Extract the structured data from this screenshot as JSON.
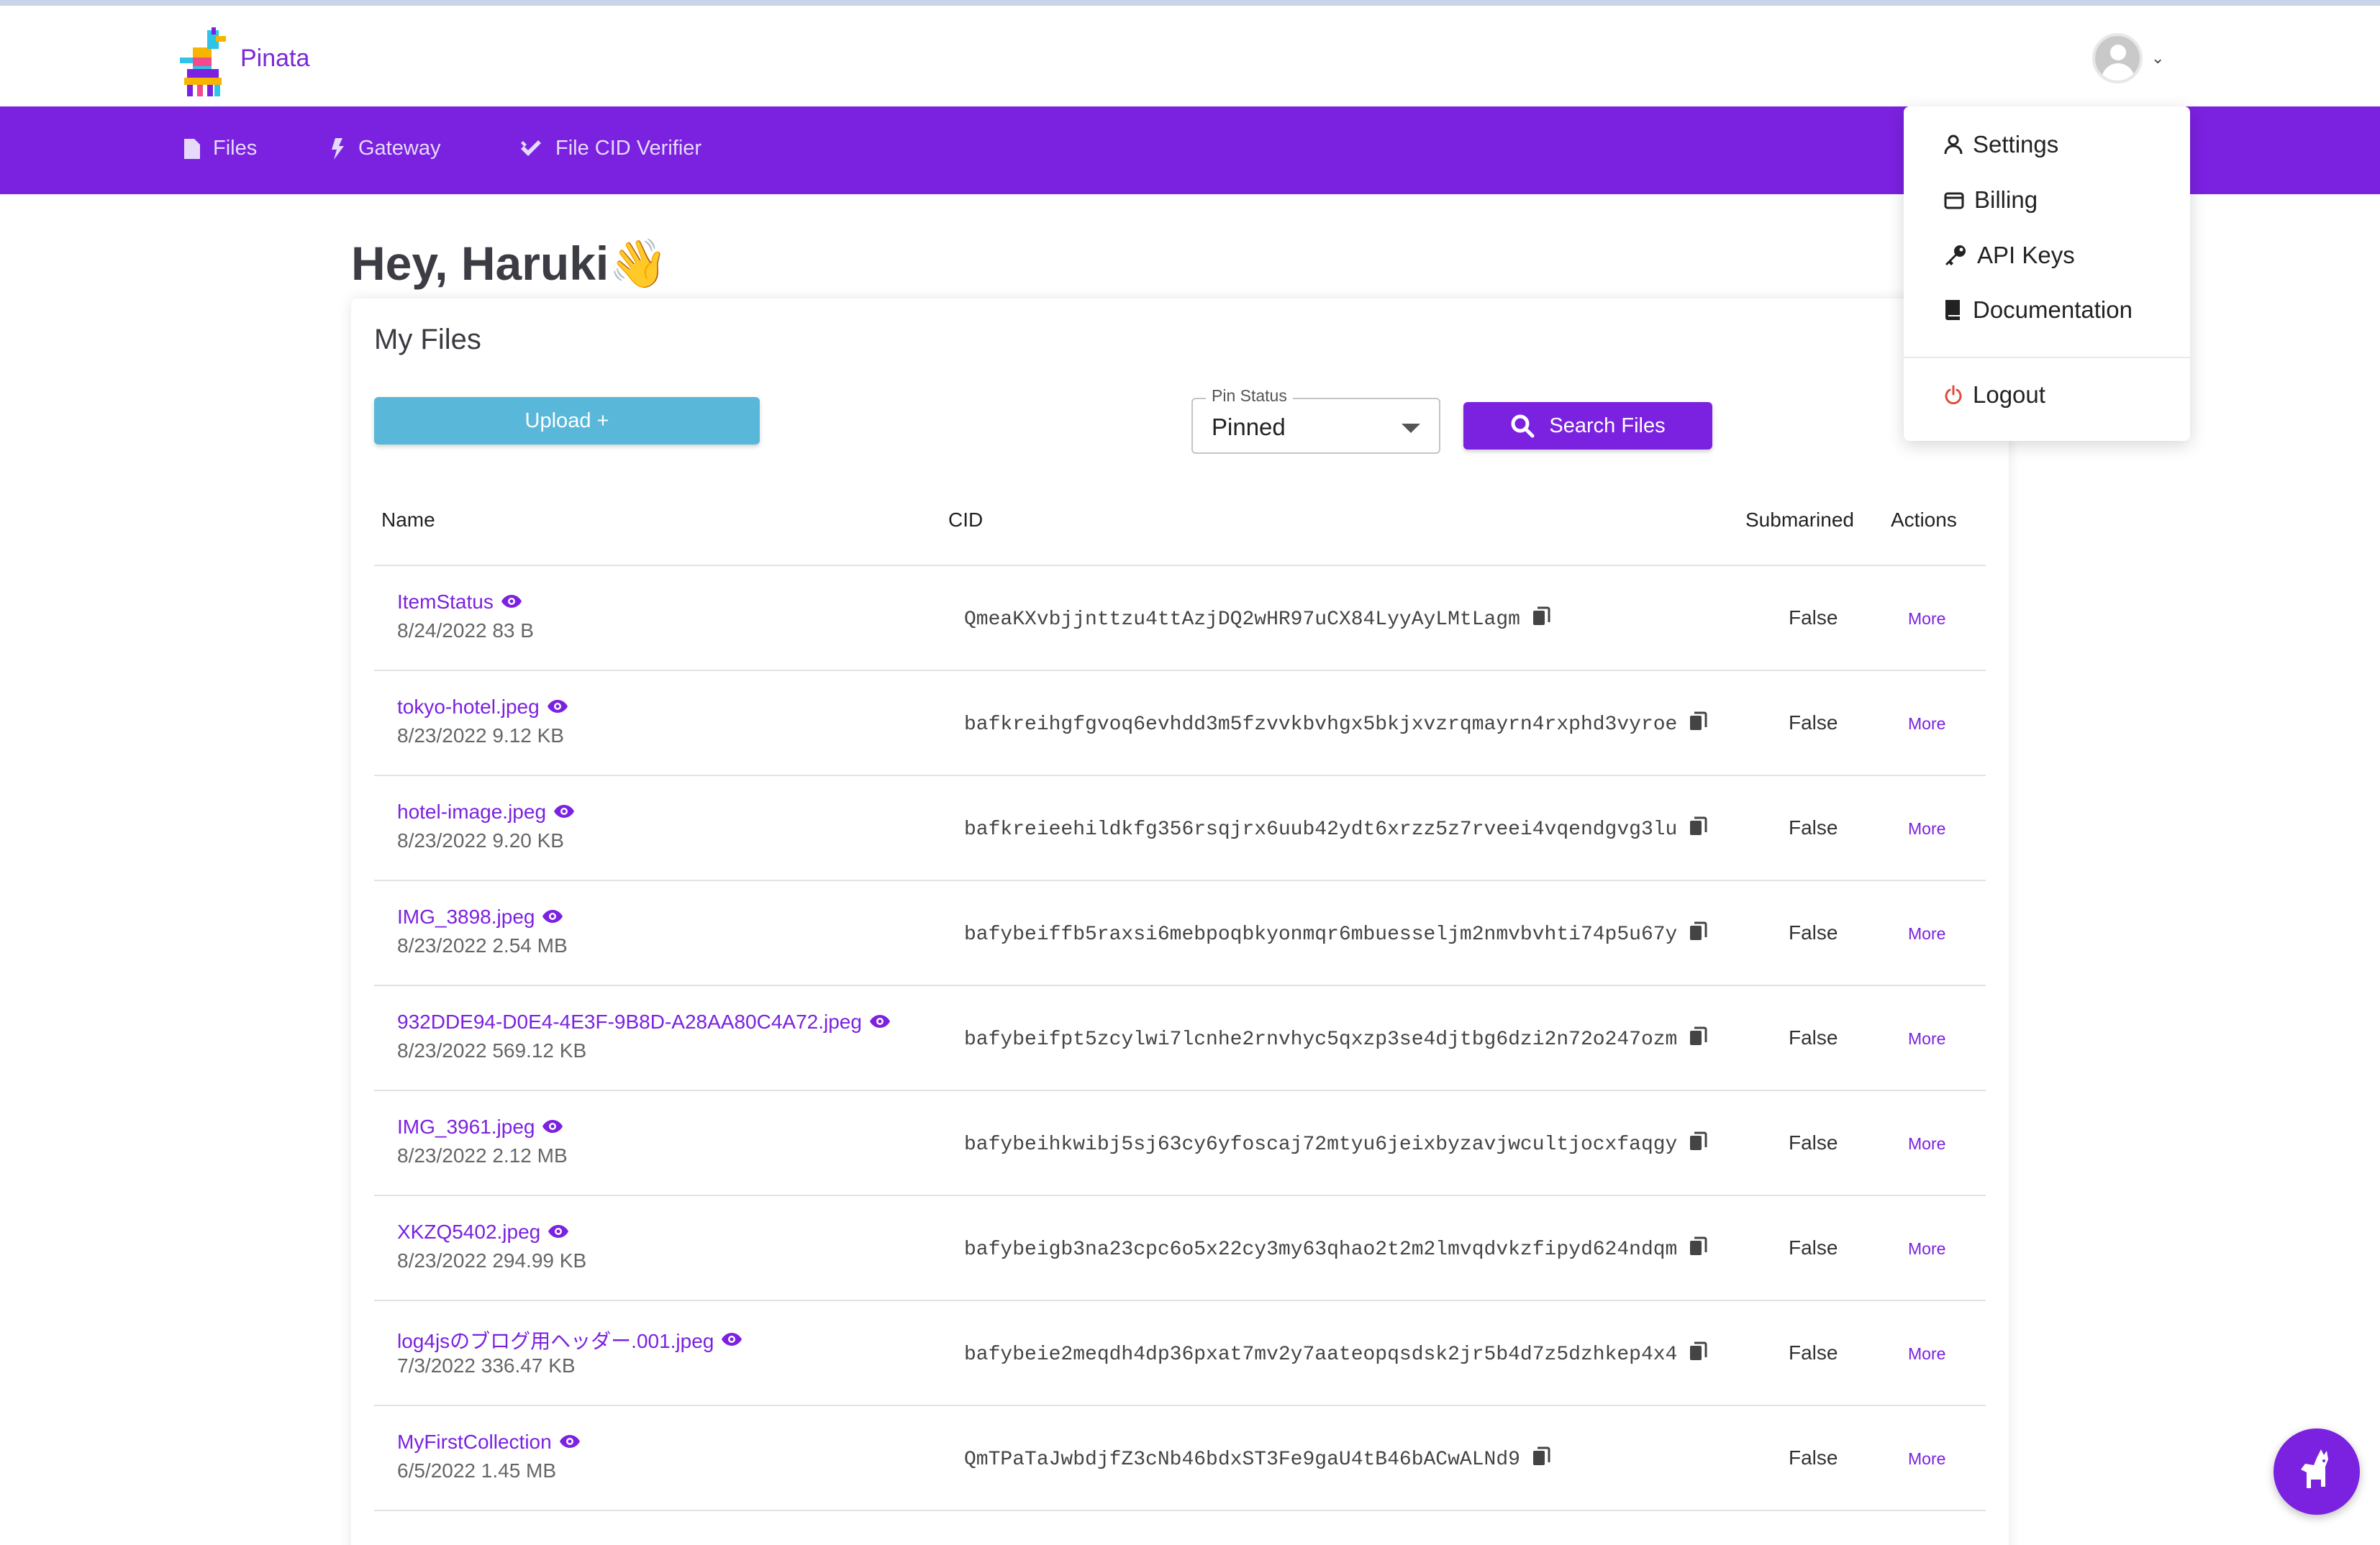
{
  "app": {
    "brand": "Pinata"
  },
  "nav": {
    "items": [
      {
        "label": "Files",
        "icon": "file-icon"
      },
      {
        "label": "Gateway",
        "icon": "bolt-icon"
      },
      {
        "label": "File CID Verifier",
        "icon": "double-check-icon"
      }
    ]
  },
  "greeting": "Hey, Haruki👋",
  "files": {
    "title": "My Files",
    "upload_label": "Upload +",
    "pin_status": {
      "label": "Pin Status",
      "value": "Pinned"
    },
    "search_label": "Search Files",
    "columns": [
      "Name",
      "CID",
      "Submarined",
      "Actions"
    ],
    "rows": [
      {
        "name": "ItemStatus",
        "meta": "8/24/2022 83 B",
        "cid": "QmeaKXvbjjnttzu4ttAzjDQ2wHR97uCX84LyyAyLMtLagm",
        "submarined": "False",
        "action": "More"
      },
      {
        "name": "tokyo-hotel.jpeg",
        "meta": "8/23/2022 9.12 KB",
        "cid": "bafkreihgfgvoq6evhdd3m5fzvvkbvhgx5bkjxvzrqmayrn4rxphd3vyroe",
        "submarined": "False",
        "action": "More"
      },
      {
        "name": "hotel-image.jpeg",
        "meta": "8/23/2022 9.20 KB",
        "cid": "bafkreieehildkfg356rsqjrx6uub42ydt6xrzz5z7rveei4vqendgvg3lu",
        "submarined": "False",
        "action": "More"
      },
      {
        "name": "IMG_3898.jpeg",
        "meta": "8/23/2022 2.54 MB",
        "cid": "bafybeiffb5raxsi6mebpoqbkyonmqr6mbuesseljm2nmvbvhti74p5u67y",
        "submarined": "False",
        "action": "More"
      },
      {
        "name": "932DDE94-D0E4-4E3F-9B8D-A28AA80C4A72.jpeg",
        "meta": "8/23/2022 569.12 KB",
        "cid": "bafybeifpt5zcylwi7lcnhe2rnvhyc5qxzp3se4djtbg6dzi2n72o247ozm",
        "submarined": "False",
        "action": "More"
      },
      {
        "name": "IMG_3961.jpeg",
        "meta": "8/23/2022 2.12 MB",
        "cid": "bafybeihkwibj5sj63cy6yfoscaj72mtyu6jeixbyzavjwcultjocxfaqgy",
        "submarined": "False",
        "action": "More"
      },
      {
        "name": "XKZQ5402.jpeg",
        "meta": "8/23/2022 294.99 KB",
        "cid": "bafybeigb3na23cpc6o5x22cy3my63qhao2t2m2lmvqdvkzfipyd624ndqm",
        "submarined": "False",
        "action": "More"
      },
      {
        "name": "log4jsのブログ用ヘッダー.001.jpeg",
        "meta": "7/3/2022 336.47 KB",
        "cid": "bafybeie2meqdh4dp36pxat7mv2y7aateopqsdsk2jr5b4d7z5dzhkep4x4",
        "submarined": "False",
        "action": "More"
      },
      {
        "name": "MyFirstCollection",
        "meta": "6/5/2022 1.45 MB",
        "cid": "QmTPaTaJwbdjfZ3cNb46bdxST3Fe9gaU4tB46bACwALNd9",
        "submarined": "False",
        "action": "More"
      }
    ]
  },
  "account_menu": {
    "items": [
      {
        "label": "Settings",
        "icon": "user-icon"
      },
      {
        "label": "Billing",
        "icon": "wallet-icon"
      },
      {
        "label": "API Keys",
        "icon": "key-icon"
      },
      {
        "label": "Documentation",
        "icon": "book-icon"
      }
    ],
    "logout_label": "Logout"
  },
  "colors": {
    "accent": "#7b21e0",
    "upload": "#59b8d9",
    "logout_icon": "#e04b3c"
  }
}
